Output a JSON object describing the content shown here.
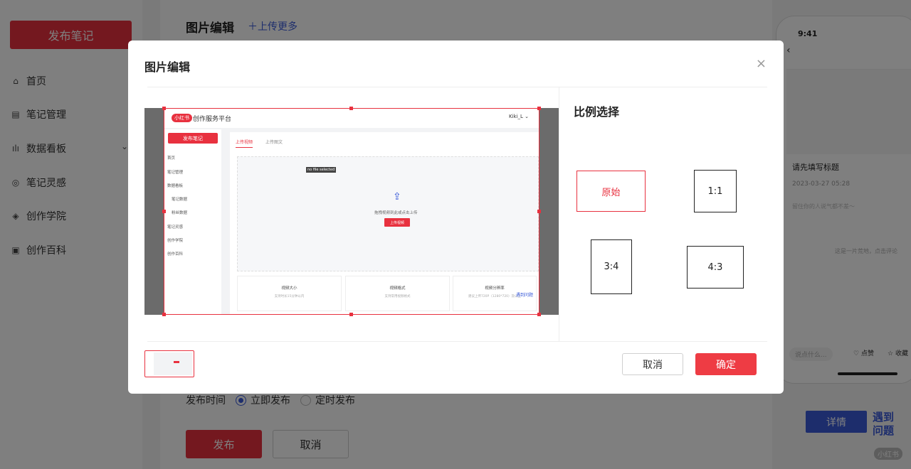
{
  "sidebar": {
    "publish_label": "发布笔记",
    "items": [
      {
        "label": "首页",
        "icon": "home-icon",
        "glyph": "⌂"
      },
      {
        "label": "笔记管理",
        "icon": "note-icon",
        "glyph": "▤"
      },
      {
        "label": "数据看板",
        "icon": "chart-icon",
        "glyph": "ılı",
        "chevron": "⌄"
      },
      {
        "label": "笔记灵感",
        "icon": "inspiration-icon",
        "glyph": "◎"
      },
      {
        "label": "创作学院",
        "icon": "academy-icon",
        "glyph": "◈"
      },
      {
        "label": "创作百科",
        "icon": "wiki-icon",
        "glyph": "▣"
      }
    ]
  },
  "main": {
    "title": "图片编辑",
    "upload_more": "＋上传更多",
    "publish_time_label": "发布时间",
    "publish_now": "立即发布",
    "publish_scheduled": "定时发布",
    "publish_button": "发布",
    "cancel_button": "取消"
  },
  "preview_phone": {
    "time": "9:41",
    "note_title": "请先填写标题",
    "date": "2023-03-27 05:28",
    "comment_placeholder": "留住你的人说气都不差～",
    "empty_text": "这是一片荒地，点击评论",
    "say_placeholder": "说点什么...",
    "like_label": "点赞",
    "fav_label": "收藏"
  },
  "floating": {
    "detail_button": "详情",
    "help_button": "遇到问题",
    "watermark": "小红书"
  },
  "modal": {
    "title": "图片编辑",
    "close_glyph": "×",
    "ratio_title": "比例选择",
    "ratios": {
      "original": "原始",
      "r1_1": "1:1",
      "r3_4": "3:4",
      "r4_3": "4:3"
    },
    "selected_ratio": "原始",
    "cancel": "取消",
    "confirm": "确定"
  },
  "screenshot": {
    "logo": "小红书",
    "brand": "创作服务平台",
    "user": "Kiki_L ⌄",
    "publish": "发布笔记",
    "nav": [
      "首页",
      "笔记管理",
      "数据看板",
      "笔记数据",
      "粉丝数据",
      "笔记灵感",
      "创作学院",
      "创作百科"
    ],
    "tab_video": "上传视频",
    "tab_image": "上传图文",
    "tooltip": "no file selected",
    "drop_hint": "拖拽视频到此或点击上传",
    "upload_btn": "上传视频",
    "cards": [
      {
        "title": "视频大小",
        "sub": "支持时长15分钟以内"
      },
      {
        "title": "视频格式",
        "sub": "支持常用视频格式"
      },
      {
        "title": "视频分辨率",
        "sub": "建议上传720P（1280*720）及以上"
      }
    ],
    "help": "遇到问题"
  },
  "colors": {
    "accent": "#e8313f",
    "link": "#3a5bd9"
  }
}
